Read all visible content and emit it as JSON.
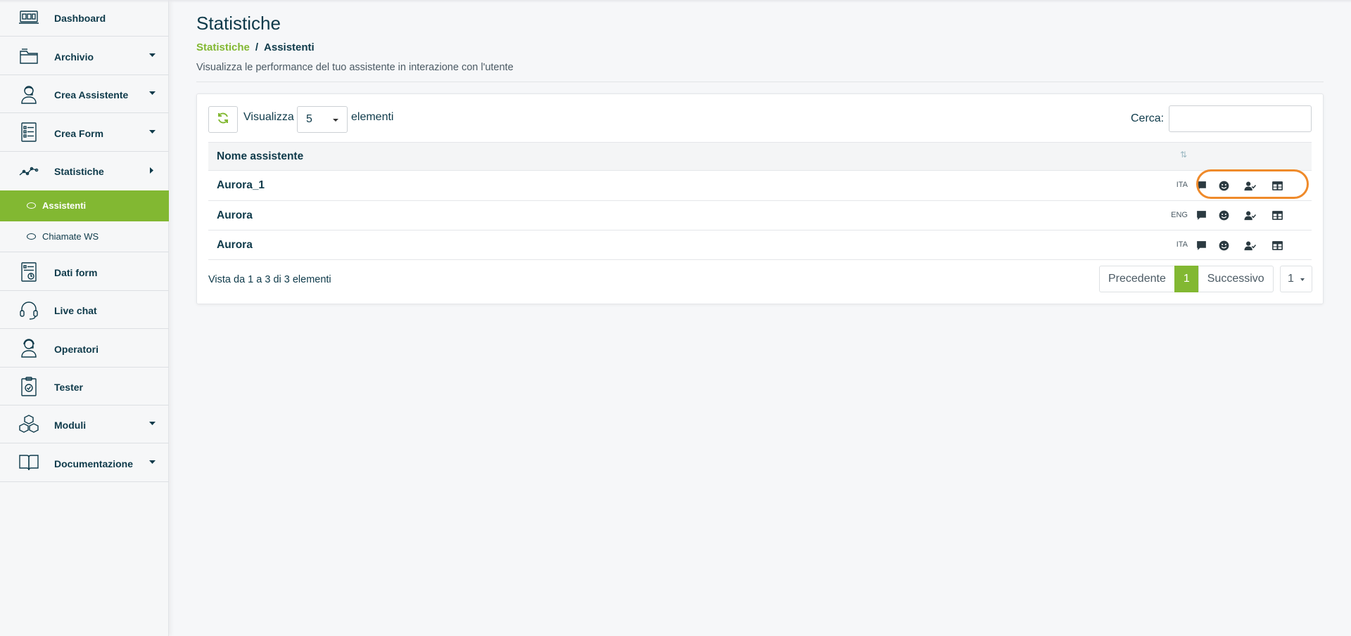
{
  "sidebar": {
    "items": [
      {
        "label": "Dashboard",
        "icon": "dashboard-icon"
      },
      {
        "label": "Archivio",
        "icon": "folder-icon"
      },
      {
        "label": "Crea Assistente",
        "icon": "assistant-icon"
      },
      {
        "label": "Crea Form",
        "icon": "form-icon"
      },
      {
        "label": "Statistiche",
        "icon": "stats-icon"
      },
      {
        "label": "Dati form",
        "icon": "form-data-icon"
      },
      {
        "label": "Live chat",
        "icon": "headset-icon"
      },
      {
        "label": "Operatori",
        "icon": "operator-icon"
      },
      {
        "label": "Tester",
        "icon": "tester-icon"
      },
      {
        "label": "Moduli",
        "icon": "modules-icon"
      },
      {
        "label": "Documentazione",
        "icon": "book-icon"
      }
    ],
    "subitems": [
      {
        "label": "Assistenti",
        "active": true
      },
      {
        "label": "Chiamate WS",
        "active": false
      }
    ]
  },
  "header": {
    "title": "Statistiche",
    "breadcrumb": {
      "link": "Statistiche",
      "separator": "/",
      "current": "Assistenti"
    },
    "subtitle": "Visualizza le performance del tuo assistente in interazione con l'utente"
  },
  "table_controls": {
    "show_label": "Visualizza",
    "page_length": "5",
    "elements_label": "elementi",
    "search_label": "Cerca:",
    "search_value": ""
  },
  "table": {
    "header_name": "Nome assistente",
    "sort_icon": "⇅",
    "rows": [
      {
        "name": "Aurora_1",
        "lang": "ITA"
      },
      {
        "name": "Aurora",
        "lang": "ENG"
      },
      {
        "name": "Aurora",
        "lang": "ITA"
      }
    ],
    "action_icons": [
      "chat-icon",
      "smiley-icon",
      "user-check-icon",
      "table-icon"
    ]
  },
  "footer": {
    "info": "Vista da 1 a 3 di 3 elementi",
    "prev": "Precedente",
    "page": "1",
    "next": "Successivo",
    "page_select": "1"
  },
  "colors": {
    "accent": "#82b832",
    "text": "#0e3a4a",
    "highlight": "#ef8a2a"
  }
}
